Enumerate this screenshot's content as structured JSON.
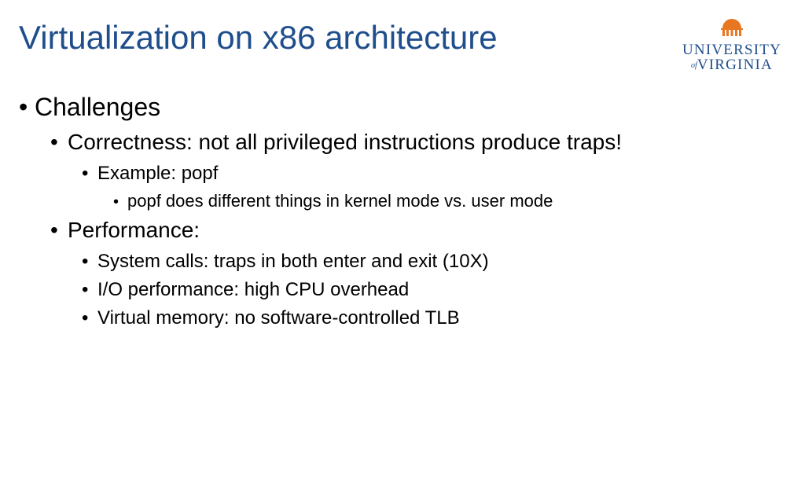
{
  "title": "Virtualization on x86 architecture",
  "logo": {
    "line1": "UNIVERSITY",
    "of": "of",
    "line2": "VIRGINIA"
  },
  "bullets": {
    "l1_0": "Challenges",
    "l2_0": "Correctness: not all privileged instructions produce traps!",
    "l3_0": "Example: popf",
    "l4_0": "popf does different things in kernel mode vs. user mode",
    "l2_1": "Performance:",
    "l3_1": "System calls: traps in both enter and exit (10X)",
    "l3_2": "I/O performance: high CPU overhead",
    "l3_3": "Virtual memory: no software-controlled TLB"
  }
}
